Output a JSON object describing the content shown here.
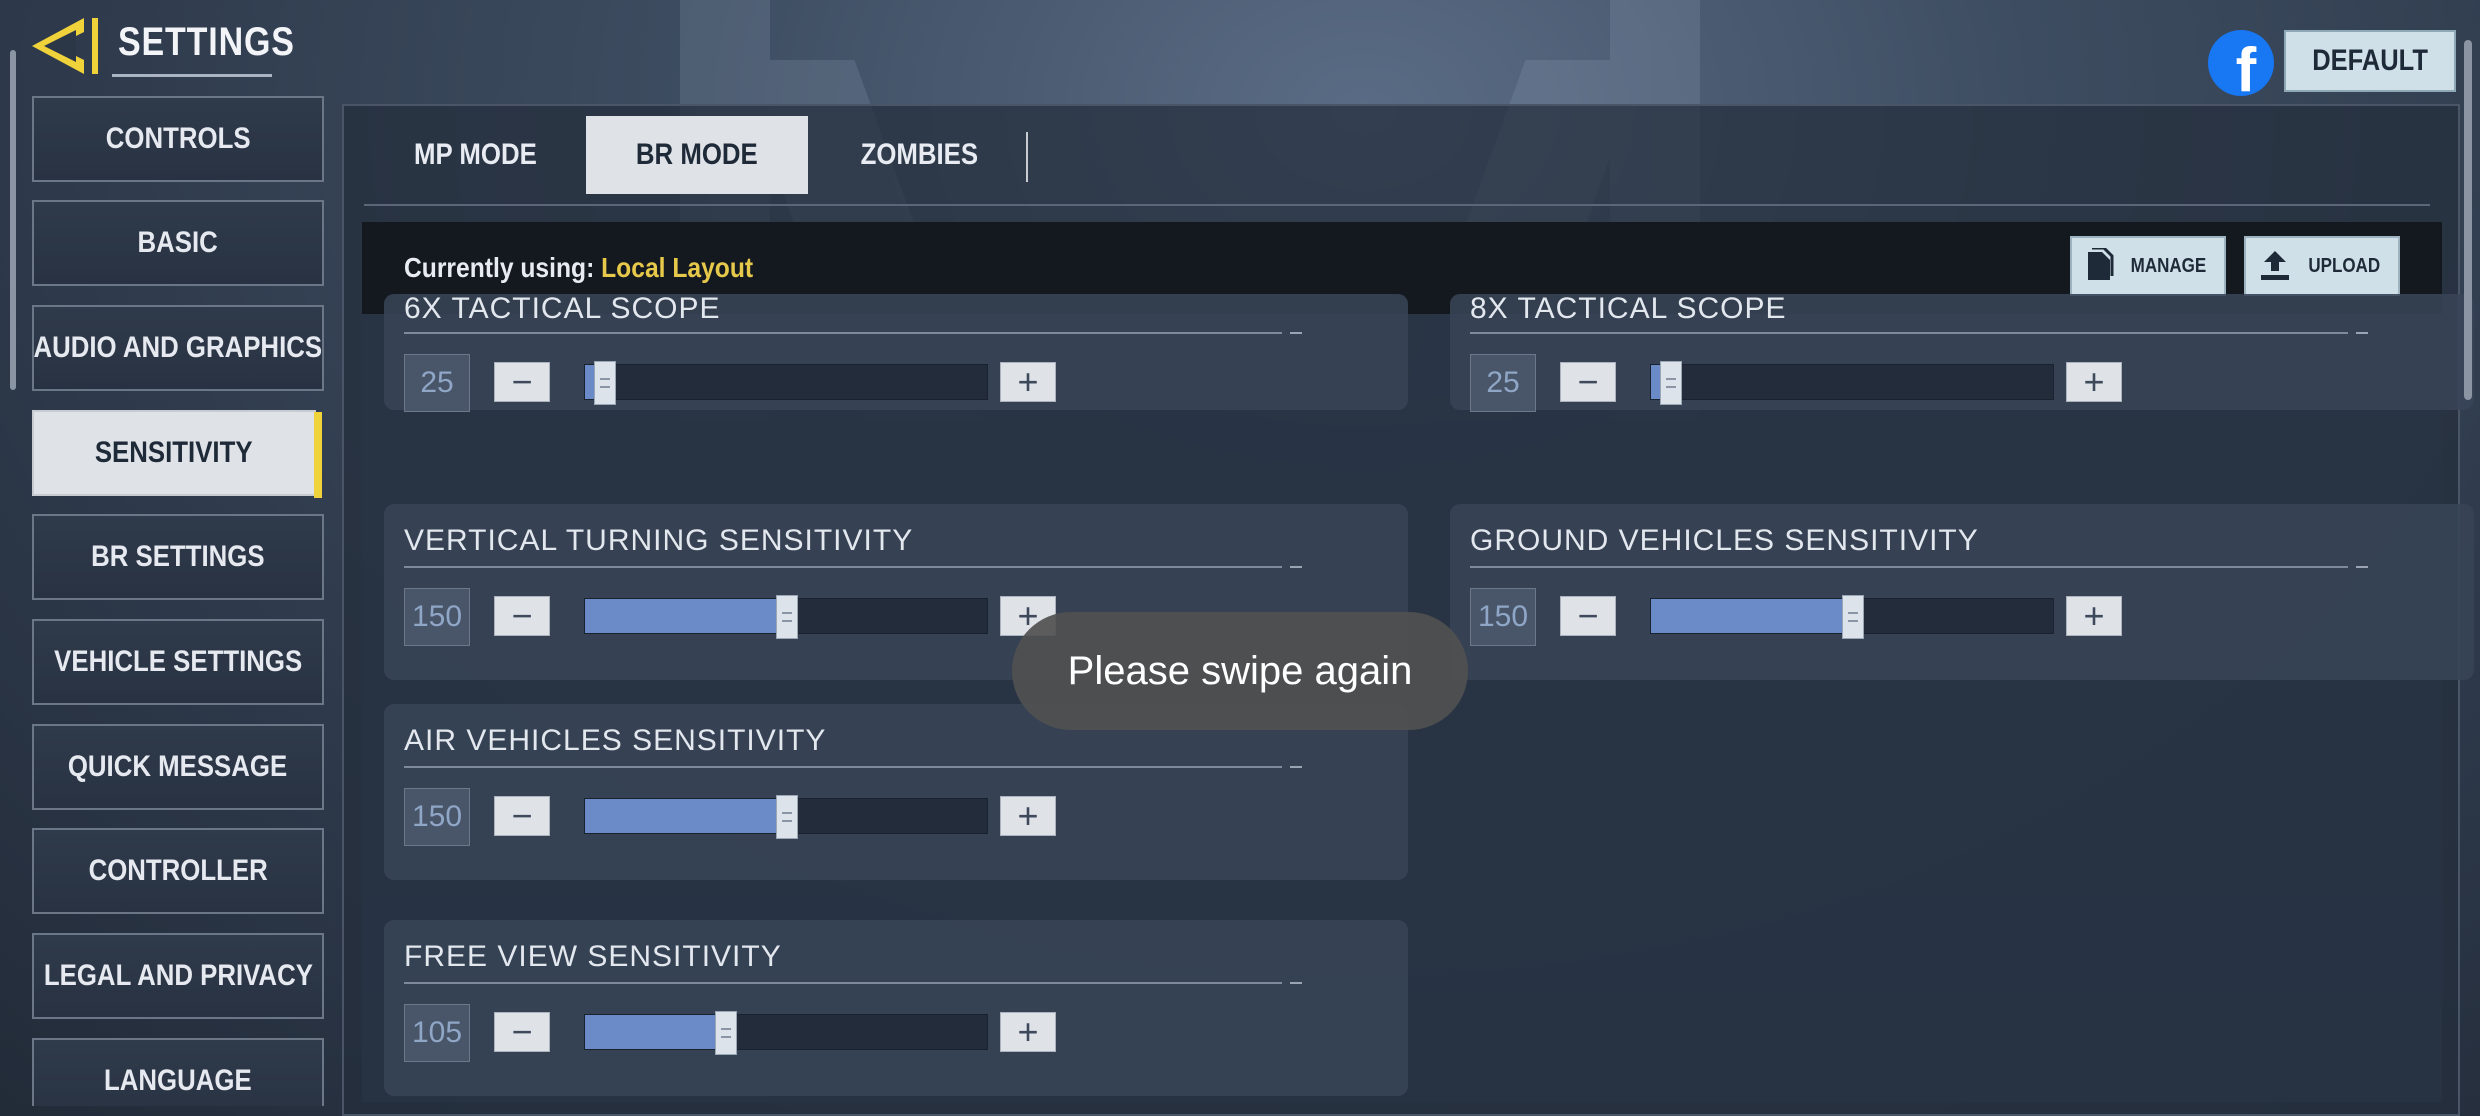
{
  "header": {
    "title": "SETTINGS",
    "default_label": "DEFAULT",
    "facebook_glyph": "f"
  },
  "colors": {
    "accent_yellow": "#f0d23a",
    "layout_name": "#e6c94a",
    "slider_fill": "#6a8bc8",
    "facebook": "#1877f2"
  },
  "nav": {
    "items": [
      {
        "label": "CONTROLS"
      },
      {
        "label": "BASIC"
      },
      {
        "label": "AUDIO AND GRAPHICS"
      },
      {
        "label": "SENSITIVITY",
        "active": true
      },
      {
        "label": "BR SETTINGS"
      },
      {
        "label": "VEHICLE SETTINGS"
      },
      {
        "label": "QUICK MESSAGE"
      },
      {
        "label": "CONTROLLER"
      },
      {
        "label": "LEGAL AND PRIVACY"
      },
      {
        "label": "LANGUAGE"
      }
    ]
  },
  "tabs": [
    {
      "label": "MP MODE"
    },
    {
      "label": "BR MODE",
      "active": true
    },
    {
      "label": "ZOMBIES"
    }
  ],
  "layout_bar": {
    "prefix": "Currently using:",
    "layout_name": "Local Layout",
    "manage_label": "MANAGE",
    "upload_label": "UPLOAD"
  },
  "settings": [
    {
      "name": "6X TACTICAL SCOPE",
      "value": "25",
      "fraction": 0.05
    },
    {
      "name": "8X TACTICAL SCOPE",
      "value": "25",
      "fraction": 0.05
    },
    {
      "name": "VERTICAL TURNING SENSITIVITY",
      "value": "150",
      "fraction": 0.5
    },
    {
      "name": "GROUND VEHICLES SENSITIVITY",
      "value": "150",
      "fraction": 0.5
    },
    {
      "name": "AIR VEHICLES SENSITIVITY",
      "value": "150",
      "fraction": 0.5
    },
    {
      "name": "FREE VIEW SENSITIVITY",
      "value": "105",
      "fraction": 0.35
    }
  ],
  "stepper": {
    "minus": "−",
    "plus": "+"
  },
  "toast": "Please swipe again",
  "icons": {
    "back": "back-arrow-icon",
    "facebook": "facebook-icon",
    "manage": "document-icon",
    "upload": "upload-icon"
  }
}
